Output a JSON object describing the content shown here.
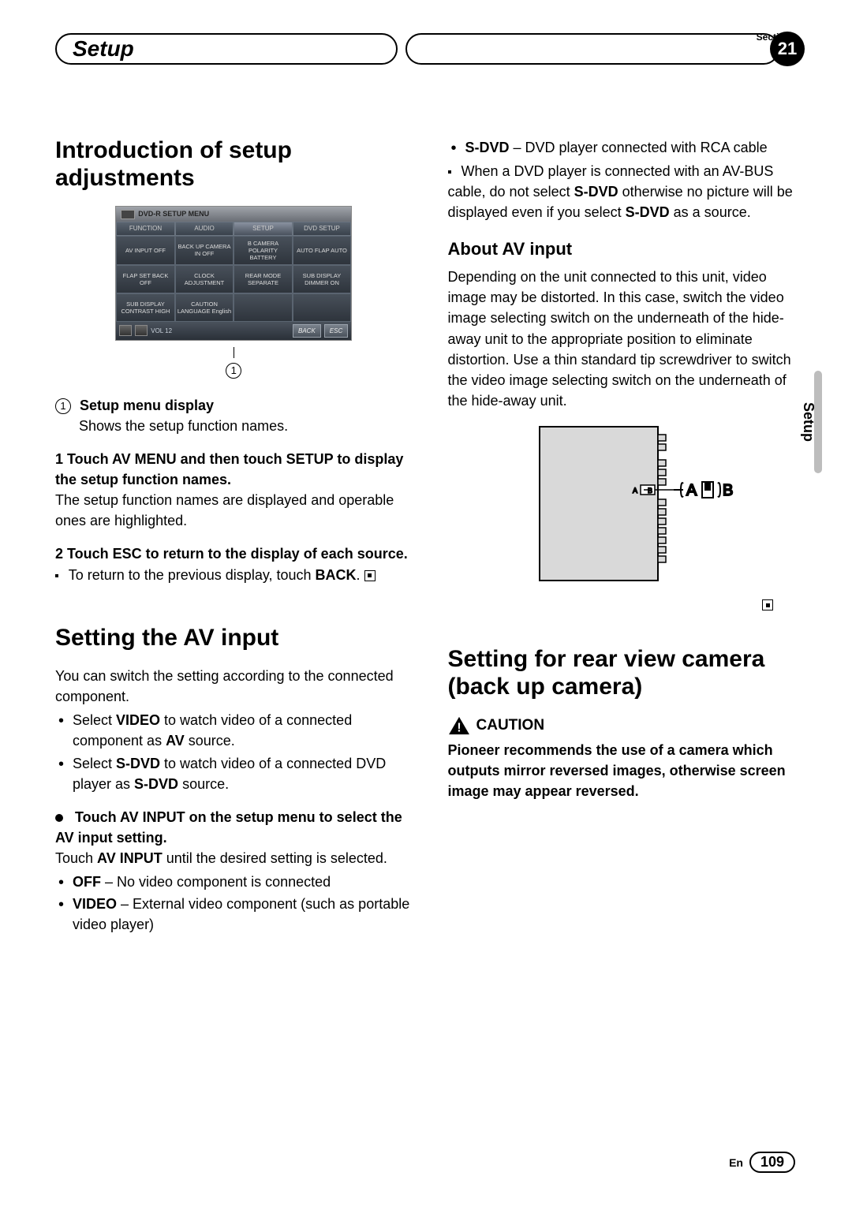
{
  "header": {
    "left_title": "Setup",
    "section_label": "Section",
    "section_number": "21"
  },
  "side_tab": "Setup",
  "footer": {
    "lang": "En",
    "page": "109"
  },
  "screenshot": {
    "title": "DVD-R SETUP MENU",
    "tabs": [
      "FUNCTION",
      "AUDIO",
      "SETUP",
      "DVD SETUP"
    ],
    "cells": [
      "AV INPUT\nOFF",
      "BACK UP\nCAMERA IN\nOFF",
      "B CAMERA\nPOLARITY\nBATTERY",
      "AUTO FLAP\nAUTO",
      "FLAP\nSET BACK\nOFF",
      "CLOCK\nADJUSTMENT",
      "REAR MODE\nSEPARATE",
      "SUB DISPLAY\nDIMMER\nON",
      "SUB DISPLAY\nCONTRAST\nHIGH",
      "CAUTION\nLANGUAGE\nEnglish",
      "",
      ""
    ],
    "vol": "VOL 12",
    "back": "BACK",
    "esc": "ESC"
  },
  "left": {
    "h1a": "Introduction of setup adjustments",
    "item1_label": "Setup menu display",
    "item1_desc": "Shows the setup function names.",
    "step1_bold": "1   Touch AV MENU and then touch SETUP to display the setup function names.",
    "step1_body": "The setup function names are displayed and operable ones are highlighted.",
    "step2_bold": "2   Touch ESC to return to the display of each source.",
    "step2_note_a": "To return to the previous display, touch",
    "step2_note_b": "BACK",
    "h1b": "Setting the AV input",
    "avintro": "You can switch the setting according to the connected component.",
    "bul1a": "Select ",
    "bul1b": "VIDEO",
    "bul1c": " to watch video of a connected component as ",
    "bul1d": "AV",
    "bul1e": " source.",
    "bul2a": "Select ",
    "bul2b": "S-DVD",
    "bul2c": " to watch video of a connected DVD player as ",
    "bul2d": "S-DVD",
    "bul2e": " source.",
    "touch_bold": "Touch AV INPUT on the setup menu to select the AV input setting.",
    "touch_body_a": "Touch ",
    "touch_body_b": "AV INPUT",
    "touch_body_c": " until the desired setting is selected.",
    "opt_off_a": "OFF",
    "opt_off_b": " – No video component is connected",
    "opt_vid_a": "VIDEO",
    "opt_vid_b": " – External video component (such as portable video player)"
  },
  "right": {
    "opt_sdvd_a": "S-DVD",
    "opt_sdvd_b": " – DVD player connected with RCA cable",
    "note_a": "When a DVD player is connected with an AV-BUS cable, do not select ",
    "note_b": "S-DVD",
    "note_c": " otherwise no picture will be displayed even if you select ",
    "note_d": "S-DVD",
    "note_e": " as a source.",
    "h2": "About AV input",
    "about_body": "Depending on the unit connected to this unit, video image may be distorted. In this case, switch the video image selecting switch on the underneath of the hide-away unit to the appropriate position to eliminate distortion. Use a thin standard tip screwdriver to switch the video image selecting switch on the underneath of the hide-away unit.",
    "diag_a": "A",
    "diag_b": "B",
    "h1c": "Setting for rear view camera (back up camera)",
    "caution_label": "CAUTION",
    "caution_body": "Pioneer recommends the use of a camera which outputs mirror reversed images, otherwise screen image may appear reversed."
  }
}
